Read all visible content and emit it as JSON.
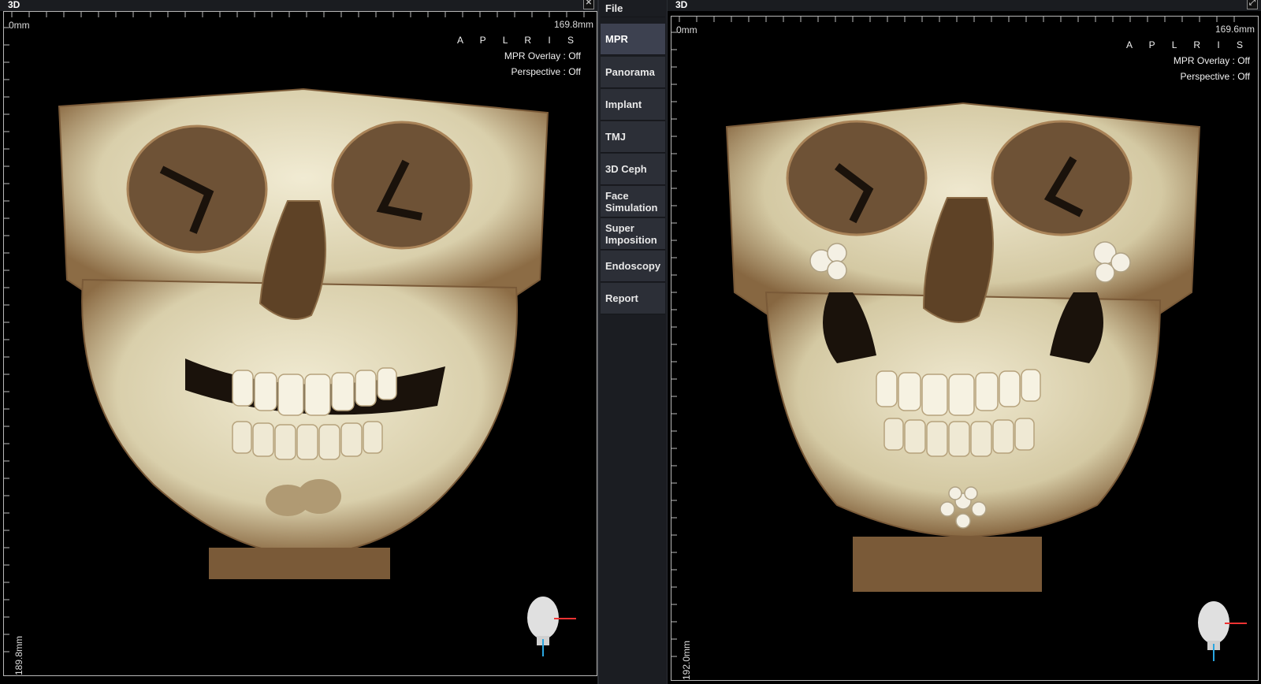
{
  "left_view": {
    "title": "3D",
    "close_glyph": "✕",
    "top_start": "0mm",
    "top_end": "169.8mm",
    "side_end": "189.8mm",
    "orientation": "A P L R I S",
    "mpr_overlay": "MPR Overlay : Off",
    "perspective": "Perspective : Off"
  },
  "right_view": {
    "title": "3D",
    "close_glyph": "⤢",
    "top_start": "0mm",
    "top_end": "169.6mm",
    "side_end": "192.0mm",
    "orientation": "A P L R I S",
    "mpr_overlay": "MPR Overlay : Off",
    "perspective": "Perspective : Off"
  },
  "menu": {
    "file": "File",
    "mpr": "MPR",
    "panorama": "Panorama",
    "implant": "Implant",
    "tmj": "TMJ",
    "ceph": "3D Ceph",
    "face_sim_1": "Face",
    "face_sim_2": "Simulation",
    "super_1": "Super",
    "super_2": "Imposition",
    "endoscopy": "Endoscopy",
    "report": "Report"
  },
  "icons": {
    "close": "close-icon",
    "expand": "expand-icon",
    "orientation_head": "head-orientation-icon",
    "skull": "skull-3d-render"
  },
  "colors": {
    "background": "#000000",
    "bone": "#e9e2c6",
    "bone_shadow": "#8a6a45",
    "menu_active": "#3d4150",
    "menu": "#2c2f37"
  }
}
